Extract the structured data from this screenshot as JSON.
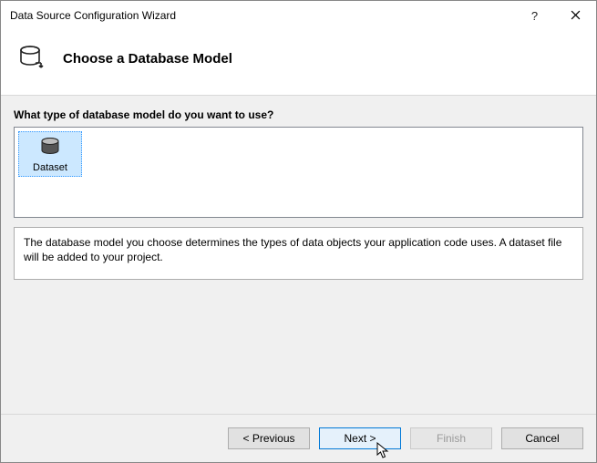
{
  "window": {
    "title": "Data Source Configuration Wizard",
    "help": "?",
    "close": "×"
  },
  "header": {
    "title": "Choose a Database Model"
  },
  "question": "What type of database model do you want to use?",
  "options": {
    "dataset": "Dataset"
  },
  "description": "The database model you choose determines the types of data objects your application code uses. A dataset file will be added to your project.",
  "buttons": {
    "previous": "< Previous",
    "next": "Next >",
    "finish": "Finish",
    "cancel": "Cancel"
  }
}
